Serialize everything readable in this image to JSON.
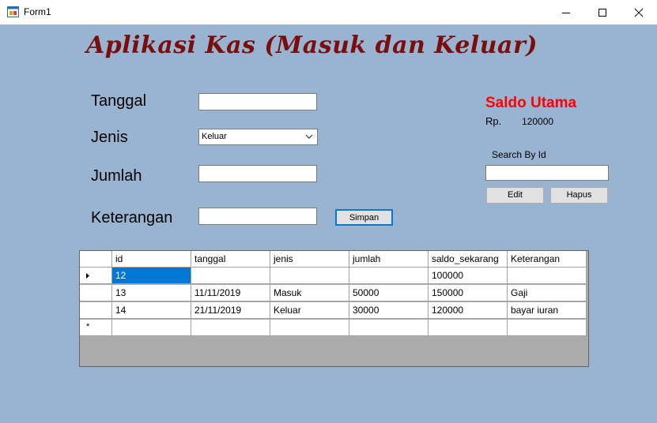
{
  "window": {
    "title": "Form1"
  },
  "header": {
    "title": "Aplikasi Kas (Masuk dan Keluar)"
  },
  "form": {
    "tanggal_label": "Tanggal",
    "jenis_label": "Jenis",
    "jumlah_label": "Jumlah",
    "keterangan_label": "Keterangan",
    "tanggal_value": "",
    "jenis_value": "Keluar",
    "jumlah_value": "",
    "keterangan_value": "",
    "save_label": "Simpan"
  },
  "saldo": {
    "title": "Saldo Utama",
    "currency": "Rp.",
    "value": "120000"
  },
  "search": {
    "label": "Search By Id",
    "value": "",
    "edit_label": "Edit",
    "delete_label": "Hapus"
  },
  "table": {
    "columns": [
      "id",
      "tanggal",
      "jenis",
      "jumlah",
      "saldo_sekarang",
      "Keterangan"
    ],
    "rows": [
      [
        "12",
        "",
        "",
        "",
        "100000",
        ""
      ],
      [
        "13",
        "11/11/2019",
        "Masuk",
        "50000",
        "150000",
        "Gaji"
      ],
      [
        "14",
        "21/11/2019",
        "Keluar",
        "30000",
        "120000",
        "bayar iuran"
      ]
    ],
    "new_row_marker": "*"
  },
  "icons": {
    "app": "app-form-icon",
    "minimize": "minimize-icon",
    "maximize": "maximize-icon",
    "close": "close-icon",
    "dropdown": "chevron-down-icon",
    "current_row": "row-pointer-icon"
  },
  "colors": {
    "background": "#99b4d1",
    "title_text": "#7a0e0e",
    "saldo_text": "#ff0000",
    "selection": "#0078d7"
  }
}
